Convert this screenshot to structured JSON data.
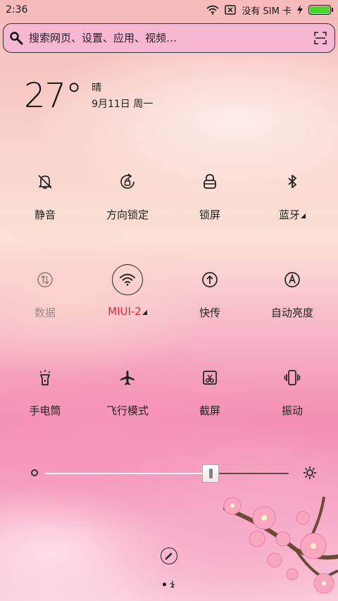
{
  "status_bar": {
    "time": "2:36",
    "carrier": "没有 SIM 卡",
    "battery_level": 1.0,
    "battery_color": "#4cd137"
  },
  "search": {
    "placeholder": "搜索网页、设置、应用、视频…",
    "search_icon": "search-icon",
    "scan_icon": "scan-icon"
  },
  "weather": {
    "temperature": "27°",
    "condition": "晴",
    "date": "9月11日 周一"
  },
  "toggles": [
    {
      "label": "静音",
      "icon": "bell-off-icon",
      "state": "off"
    },
    {
      "label": "方向锁定",
      "icon": "rotation-lock-icon",
      "state": "off"
    },
    {
      "label": "锁屏",
      "icon": "lock-icon",
      "state": "off"
    },
    {
      "label": "蓝牙",
      "icon": "bluetooth-icon",
      "state": "off",
      "has_menu": true
    },
    {
      "label": "数据",
      "icon": "data-icon",
      "state": "disabled"
    },
    {
      "label": "MIUI-2",
      "icon": "wifi-icon",
      "state": "on",
      "has_menu": true
    },
    {
      "label": "快传",
      "icon": "share-icon",
      "state": "off"
    },
    {
      "label": "自动亮度",
      "icon": "auto-brightness-icon",
      "state": "off"
    },
    {
      "label": "手电筒",
      "icon": "flashlight-icon",
      "state": "off"
    },
    {
      "label": "飞行模式",
      "icon": "airplane-icon",
      "state": "off"
    },
    {
      "label": "截屏",
      "icon": "screenshot-icon",
      "state": "off"
    },
    {
      "label": "振动",
      "icon": "vibrate-icon",
      "state": "off"
    }
  ],
  "brightness": {
    "level": 0.65
  },
  "colors": {
    "accent_active": "#e22a3a",
    "search_bg": "#f7b6d2"
  }
}
